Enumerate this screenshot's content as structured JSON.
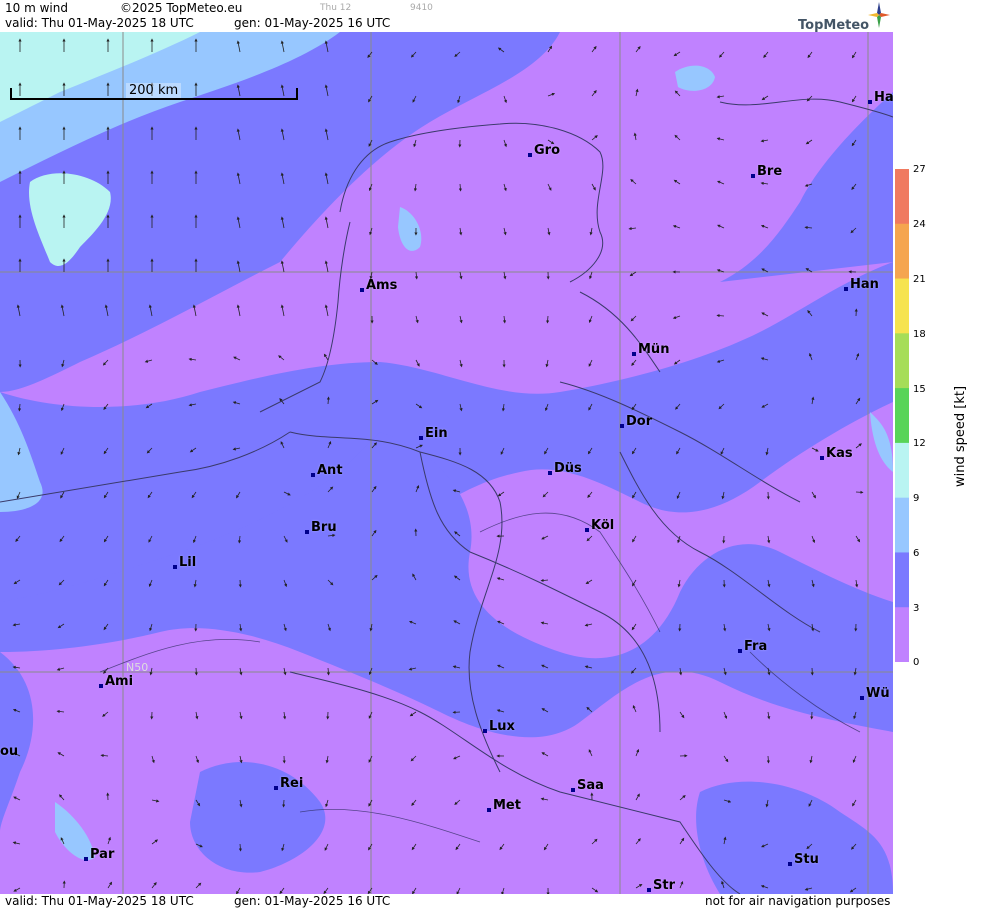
{
  "header": {
    "product": "10 m wind",
    "copyright": "©2025 TopMeteo.eu",
    "faint_day": "Thu 12",
    "faint_code": "9410",
    "valid": "valid:  Thu  01-May-2025  18 UTC",
    "generated": "gen: 01-May-2025 16 UTC"
  },
  "footer": {
    "valid": "valid:  Thu  01-May-2025  18 UTC",
    "generated": "gen: 01-May-2025 16 UTC",
    "disclaimer": "not for air navigation purposes"
  },
  "logo": {
    "text": "TopMeteo",
    "icon": "compass-star-icon"
  },
  "scale": {
    "label": "200 km"
  },
  "grid_label": "N50",
  "legend": {
    "title": "wind speed  [kt]",
    "ticks": [
      "27",
      "24",
      "21",
      "18",
      "15",
      "12",
      "9",
      "6",
      "3",
      "0"
    ],
    "colors": [
      "#f07a60",
      "#f5a54f",
      "#f6e34f",
      "#a6dd58",
      "#58d458",
      "#b9f4f2",
      "#97c7ff",
      "#7b79ff",
      "#c082ff"
    ]
  },
  "cities": [
    {
      "name": "Gro"
    },
    {
      "name": "Bre"
    },
    {
      "name": "Ha"
    },
    {
      "name": "Ams"
    },
    {
      "name": "Han"
    },
    {
      "name": "Mün"
    },
    {
      "name": "Ein"
    },
    {
      "name": "Dor"
    },
    {
      "name": "Ant"
    },
    {
      "name": "Düs"
    },
    {
      "name": "Kas"
    },
    {
      "name": "Bru"
    },
    {
      "name": "Köl"
    },
    {
      "name": "Lil"
    },
    {
      "name": "Fra"
    },
    {
      "name": "Ami"
    },
    {
      "name": "Wü"
    },
    {
      "name": "Lux"
    },
    {
      "name": "ou"
    },
    {
      "name": "Rei"
    },
    {
      "name": "Saa"
    },
    {
      "name": "Met"
    },
    {
      "name": "Par"
    },
    {
      "name": "Stu"
    },
    {
      "name": "Str"
    }
  ]
}
